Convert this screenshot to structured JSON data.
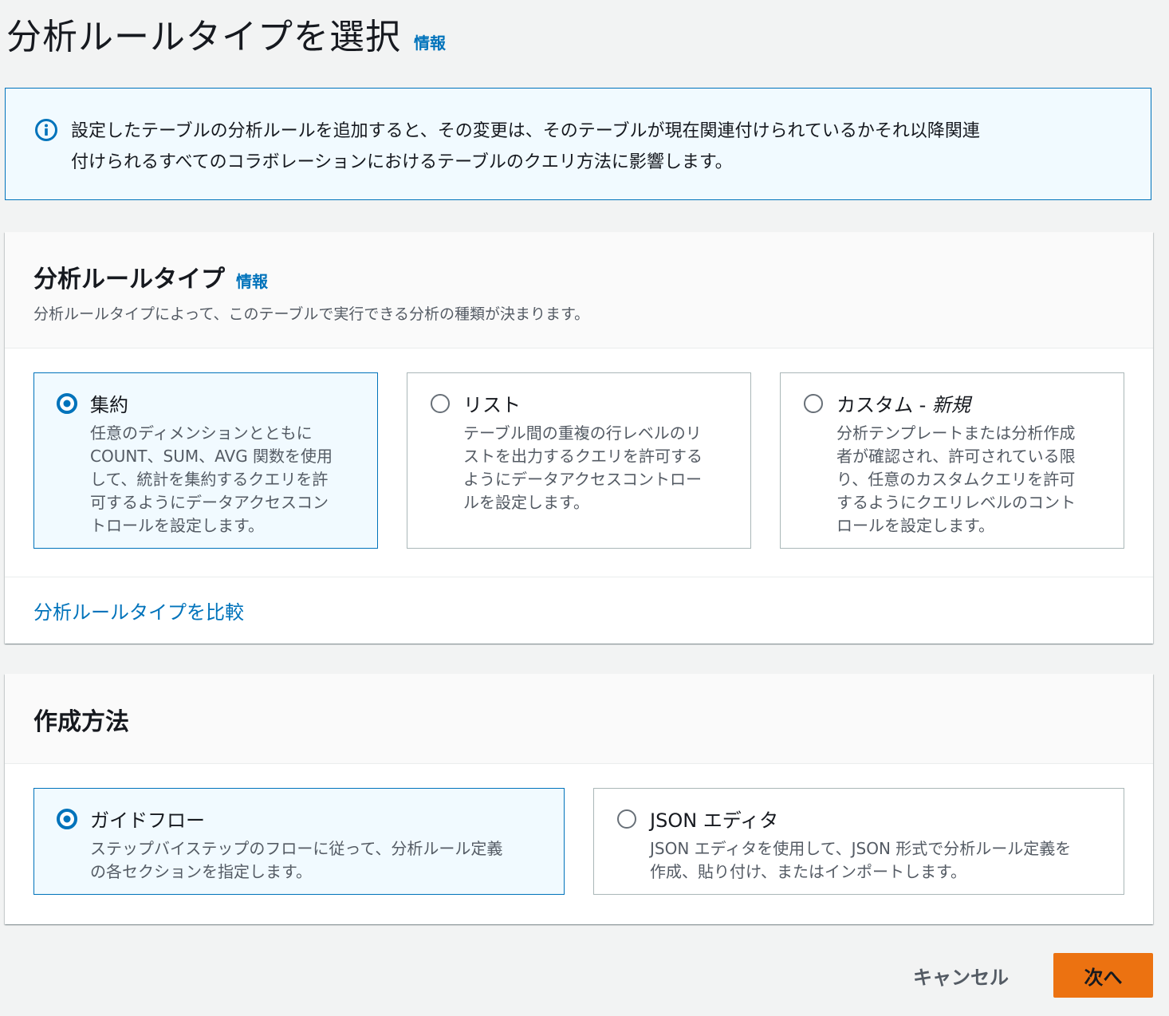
{
  "page": {
    "title": "分析ルールタイプを選択",
    "info_link": "情報"
  },
  "alert": {
    "icon": "info-circle-icon",
    "line1": "設定したテーブルの分析ルールを追加すると、その変更は、そのテーブルが現在関連付けられているかそれ以降関連",
    "line2": "付けられるすべてのコラボレーションにおけるテーブルのクエリ方法に影響します。"
  },
  "rule_type_panel": {
    "title": "分析ルールタイプ",
    "info_link": "情報",
    "description": "分析ルールタイプによって、このテーブルで実行できる分析の種類が決まります。",
    "options": [
      {
        "label": "集約",
        "label_suffix": "",
        "selected": true,
        "lines": [
          "任意のディメンションとともに",
          "COUNT、SUM、AVG 関数を使用",
          "して、統計を集約するクエリを許",
          "可するようにデータアクセスコン",
          "トロールを設定します。"
        ]
      },
      {
        "label": "リスト",
        "label_suffix": "",
        "selected": false,
        "lines": [
          "テーブル間の重複の行レベルのリ",
          "ストを出力するクエリを許可する",
          "ようにデータアクセスコントロー",
          "ルを設定します。"
        ]
      },
      {
        "label": "カスタム - ",
        "label_suffix": "新規",
        "selected": false,
        "lines": [
          "分析テンプレートまたは分析作成",
          "者が確認され、許可されている限",
          "り、任意のカスタムクエリを許可",
          "するようにクエリレベルのコント",
          "ロールを設定します。"
        ]
      }
    ],
    "compare_link": "分析ルールタイプを比較"
  },
  "creation_panel": {
    "title": "作成方法",
    "options": [
      {
        "label": "ガイドフロー",
        "selected": true,
        "lines": [
          "ステップバイステップのフローに従って、分析ルール定義",
          "の各セクションを指定します。"
        ]
      },
      {
        "label": "JSON エディタ",
        "selected": false,
        "lines": [
          "JSON エディタを使用して、JSON 形式で分析ルール定義を",
          "作成、貼り付け、またはインポートします。"
        ]
      }
    ]
  },
  "actions": {
    "cancel_label": "キャンセル",
    "next_label": "次へ"
  },
  "colors": {
    "accent": "#0073bb",
    "primary_button": "#ec7211",
    "selected_tile_bg": "#f1faff",
    "page_bg": "#f2f3f3"
  }
}
